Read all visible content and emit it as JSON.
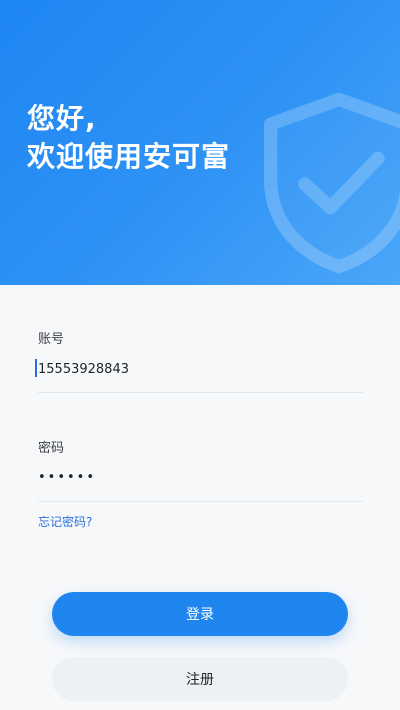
{
  "hero": {
    "line1": "您好,",
    "line2": "欢迎使用安可富",
    "background_color": "#1e86f4"
  },
  "form": {
    "account_label": "账号",
    "account_value": "15553928843",
    "password_label": "密码",
    "password_value": "••••••",
    "forgot_password": "忘记密码?"
  },
  "buttons": {
    "login": "登录",
    "register": "注册"
  },
  "icons": {
    "hero_graphic": "shield-check-icon"
  },
  "colors": {
    "primary": "#1f86ef",
    "link": "#2b72d8",
    "divider": "#e3e6ea"
  }
}
